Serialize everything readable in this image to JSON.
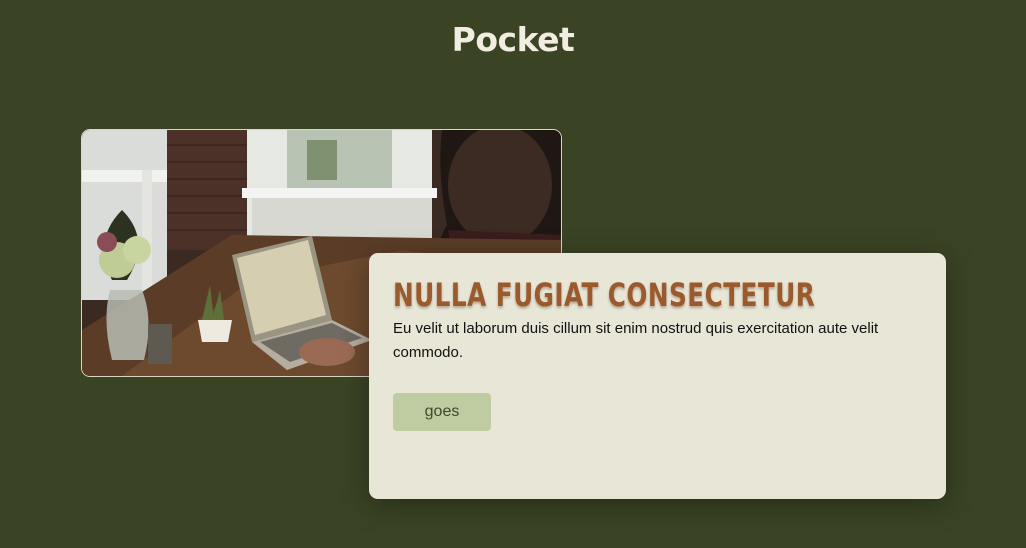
{
  "header": {
    "brand": "Pocket"
  },
  "hero": {
    "image_alt": "Person working on a laptop at a wooden desk with plants",
    "card": {
      "title": "Nulla fugiat consectetur",
      "body": "Eu velit ut laborum duis cillum sit enim nostrud quis exercitation aute velit commodo.",
      "button_label": "goes"
    }
  },
  "colors": {
    "background": "#3a4424",
    "card": "#e7e6d7",
    "title": "#9b5a2d",
    "button": "#bfcca1"
  }
}
